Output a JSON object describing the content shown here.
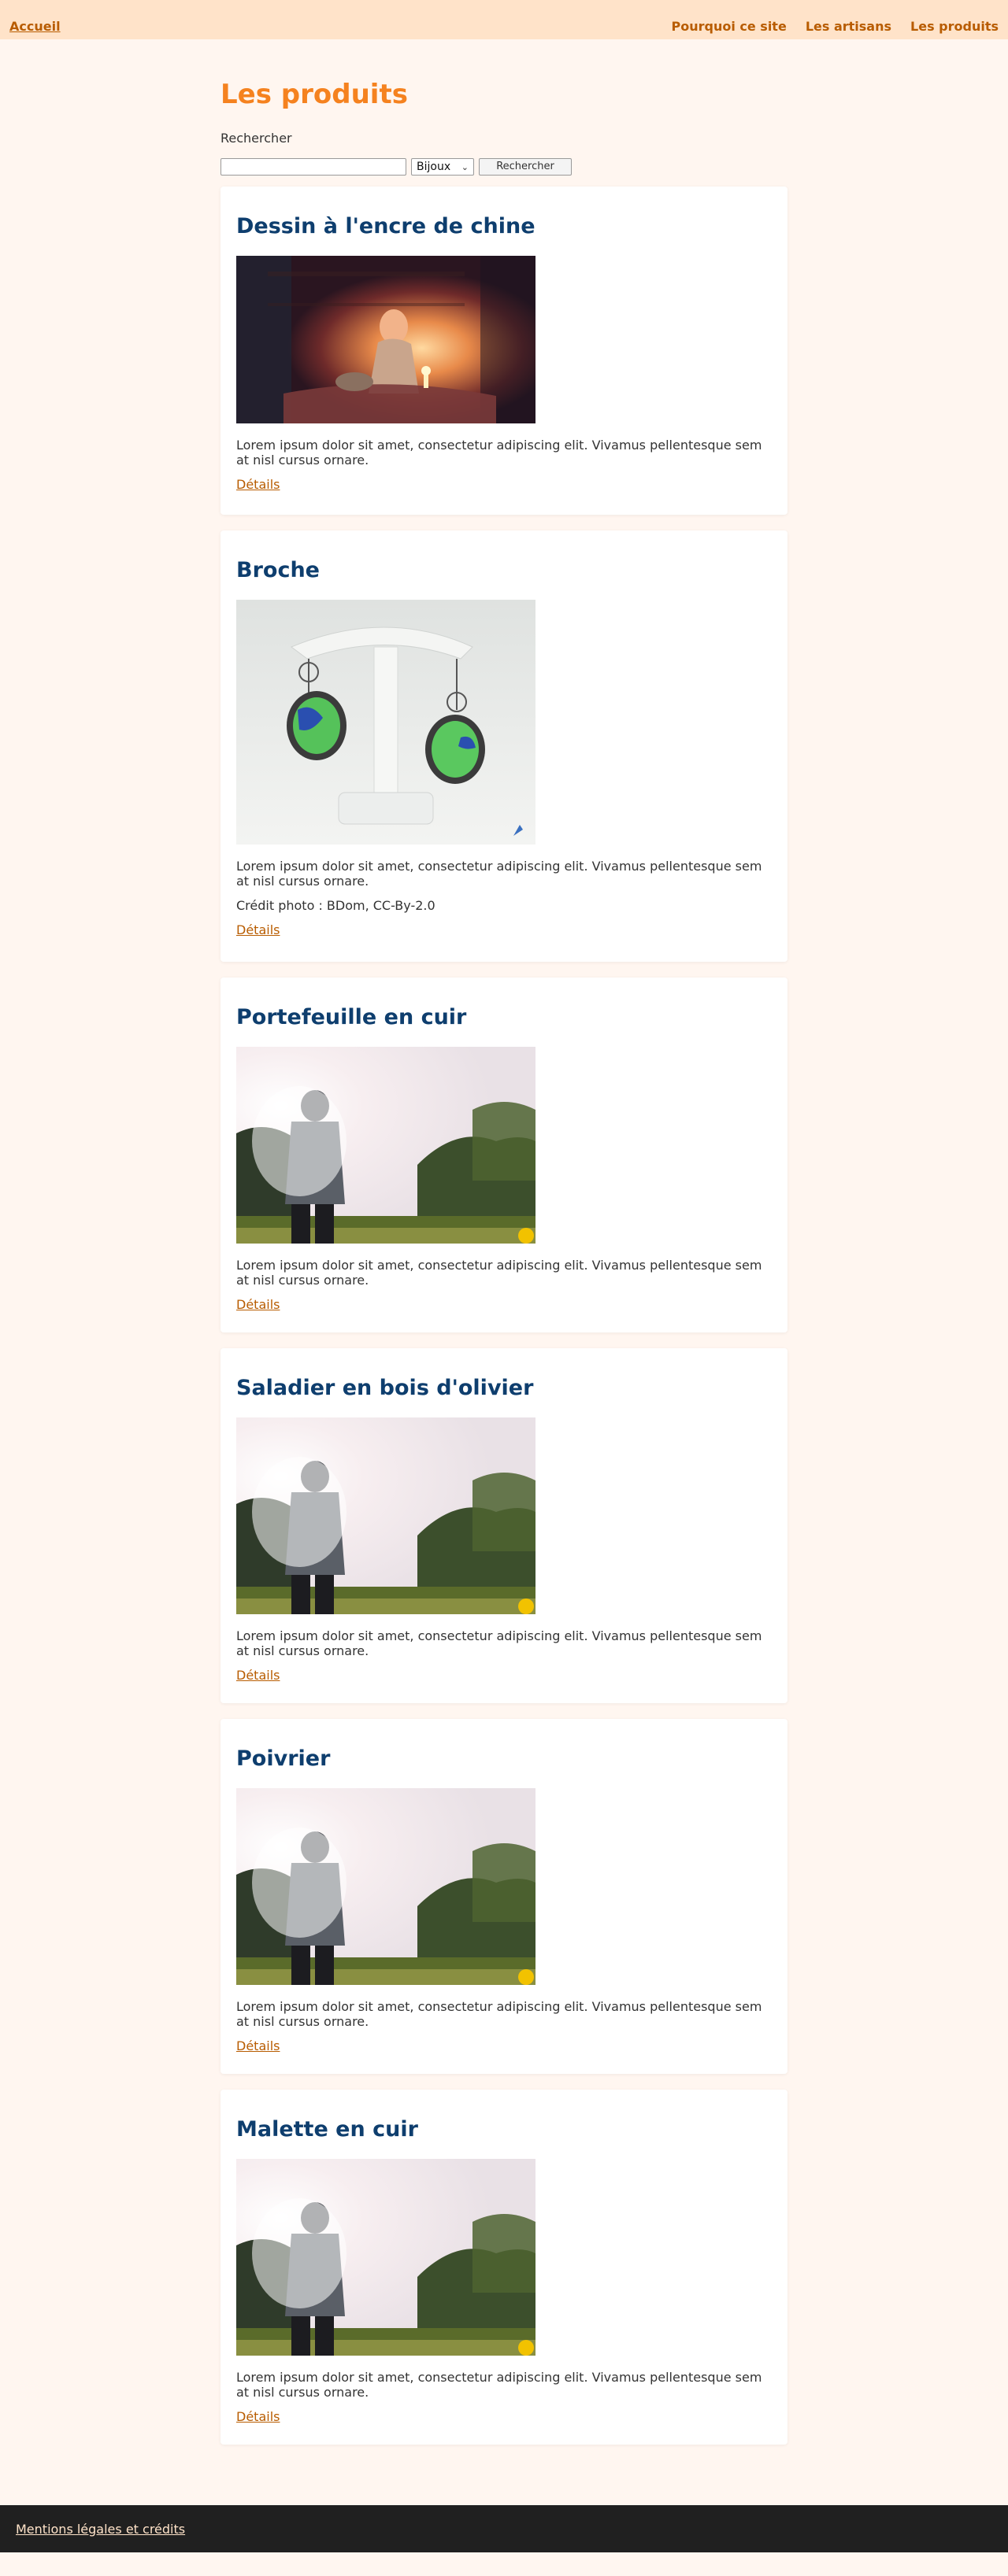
{
  "nav": {
    "home": "Accueil",
    "links": [
      "Pourquoi ce site",
      "Les artisans",
      "Les produits"
    ]
  },
  "page": {
    "title": "Les produits",
    "search_label": "Rechercher",
    "category_value": "Bijoux",
    "search_button": "Rechercher"
  },
  "products": [
    {
      "title": "Dessin à l'encre de chine",
      "image": "ink-drawing-girl-candle-photo",
      "description": "Lorem ipsum dolor sit amet, consectetur adipiscing elit. Vivamus pellentesque sem at nisl cursus ornare.",
      "credit": "",
      "details": "Détails"
    },
    {
      "title": "Broche",
      "image": "earrings-green-blue-photo",
      "description": "Lorem ipsum dolor sit amet, consectetur adipiscing elit. Vivamus pellentesque sem at nisl cursus ornare.",
      "credit": "Crédit photo : BDom, CC-By-2.0",
      "details": "Détails"
    },
    {
      "title": "Portefeuille en cuir",
      "image": "man-in-sunlit-field-photo",
      "description": "Lorem ipsum dolor sit amet, consectetur adipiscing elit. Vivamus pellentesque sem at nisl cursus ornare.",
      "credit": "",
      "details": "Détails"
    },
    {
      "title": "Saladier en bois d'olivier",
      "image": "man-in-sunlit-field-photo",
      "description": "Lorem ipsum dolor sit amet, consectetur adipiscing elit. Vivamus pellentesque sem at nisl cursus ornare.",
      "credit": "",
      "details": "Détails"
    },
    {
      "title": "Poivrier",
      "image": "man-in-sunlit-field-photo",
      "description": "Lorem ipsum dolor sit amet, consectetur adipiscing elit. Vivamus pellentesque sem at nisl cursus ornare.",
      "credit": "",
      "details": "Détails"
    },
    {
      "title": "Malette en cuir",
      "image": "man-in-sunlit-field-photo",
      "description": "Lorem ipsum dolor sit amet, consectetur adipiscing elit. Vivamus pellentesque sem at nisl cursus ornare.",
      "credit": "",
      "details": "Détails"
    }
  ],
  "footer": {
    "link": "Mentions légales et crédits"
  },
  "colors": {
    "page_bg": "#fff6f0",
    "nav_bg": "#ffe3c9",
    "nav_link": "#b85c00",
    "title": "#f5821f",
    "card_title": "#0e3e6e",
    "footer_bg": "#202020"
  }
}
